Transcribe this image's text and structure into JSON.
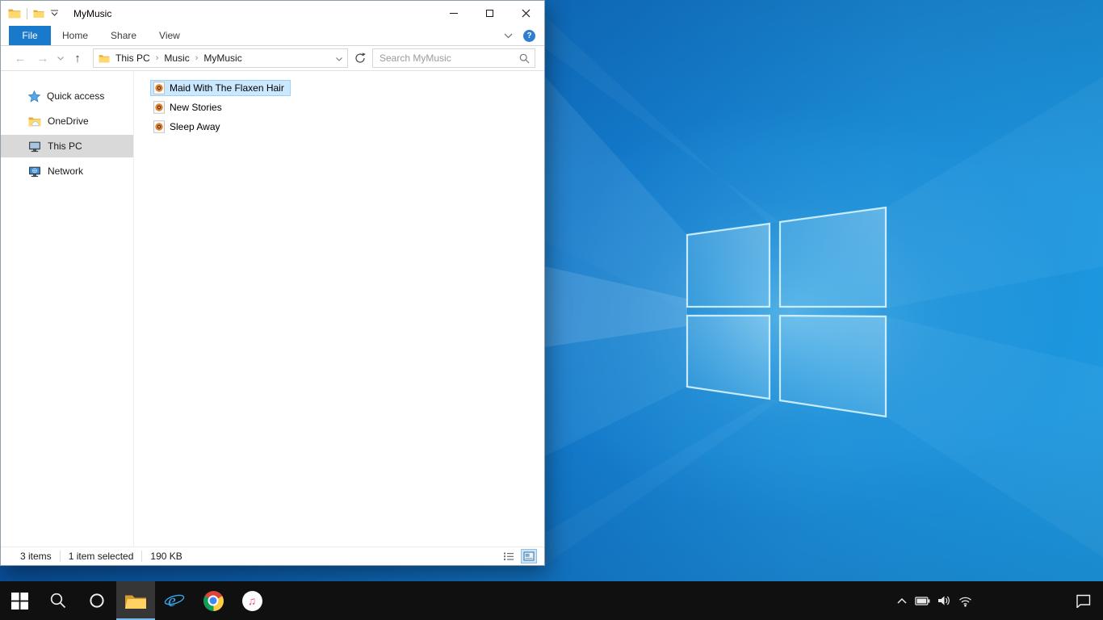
{
  "colors": {
    "accent_blue": "#1979ca",
    "file_selection_bg": "#cce8ff",
    "file_selection_border": "#99d1ff",
    "sidebar_selected_bg": "#d9d9d9",
    "taskbar_bg": "#101010",
    "desktop_blue": "#1277c8"
  },
  "window": {
    "title": "MyMusic",
    "tabs": {
      "file": "File",
      "home": "Home",
      "share": "Share",
      "view": "View"
    },
    "breadcrumb": {
      "sep": "›",
      "items": [
        "This PC",
        "Music",
        "MyMusic"
      ]
    },
    "search_placeholder": "Search MyMusic",
    "sidebar": {
      "quick_access": "Quick access",
      "onedrive": "OneDrive",
      "this_pc": "This PC",
      "network": "Network"
    },
    "files": [
      {
        "name": "Maid With The Flaxen Hair",
        "selected": true
      },
      {
        "name": "New Stories",
        "selected": false
      },
      {
        "name": "Sleep Away",
        "selected": false
      }
    ],
    "status": {
      "count": "3 items",
      "selection": "1 item selected",
      "size": "190 KB"
    }
  },
  "glyphs": {
    "back": "←",
    "forward": "→",
    "up": "↑",
    "help": "?",
    "music_note": "♫"
  },
  "icons": [
    "folder-icon",
    "qat-new-folder-icon",
    "qat-customize-chevron-icon",
    "minimize-icon",
    "maximize-icon",
    "close-icon",
    "ribbon-collapse-chevron-icon",
    "help-icon",
    "back-icon",
    "forward-icon",
    "recent-locations-chevron-icon",
    "up-icon",
    "address-folder-icon",
    "address-dropdown-chevron-icon",
    "refresh-icon",
    "search-icon",
    "quick-access-star-icon",
    "onedrive-folder-icon",
    "this-pc-icon",
    "network-icon",
    "music-file-icon",
    "details-view-icon",
    "large-icons-view-icon",
    "start-icon",
    "taskbar-search-icon",
    "cortana-icon",
    "file-explorer-icon",
    "internet-explorer-icon",
    "chrome-icon",
    "itunes-icon",
    "hidden-icons-chevron-icon",
    "battery-icon",
    "volume-icon",
    "wifi-icon",
    "action-center-icon"
  ]
}
